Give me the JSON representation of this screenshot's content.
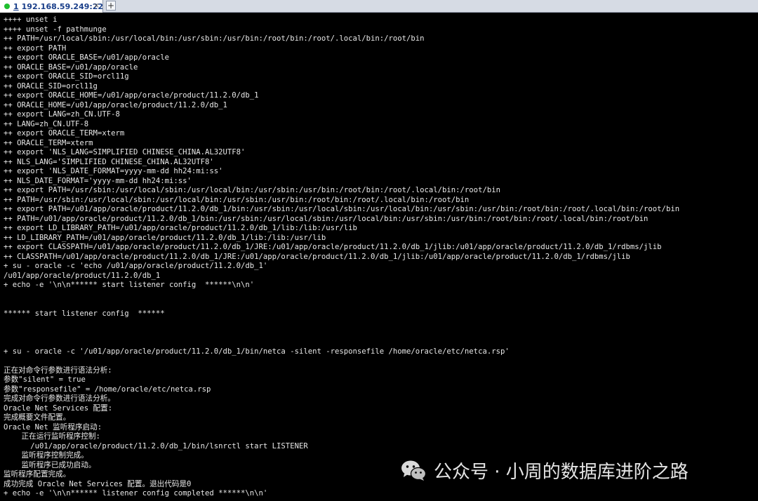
{
  "tab": {
    "number": "1",
    "title": "192.168.59.249:22",
    "close_label": "×",
    "add_label": "+"
  },
  "terminal": {
    "lines": [
      "++++ unset i",
      "++++ unset -f pathmunge",
      "++ PATH=/usr/local/sbin:/usr/local/bin:/usr/sbin:/usr/bin:/root/bin:/root/.local/bin:/root/bin",
      "++ export PATH",
      "++ export ORACLE_BASE=/u01/app/oracle",
      "++ ORACLE_BASE=/u01/app/oracle",
      "++ export ORACLE_SID=orcl11g",
      "++ ORACLE_SID=orcl11g",
      "++ export ORACLE_HOME=/u01/app/oracle/product/11.2.0/db_1",
      "++ ORACLE_HOME=/u01/app/oracle/product/11.2.0/db_1",
      "++ export LANG=zh_CN.UTF-8",
      "++ LANG=zh_CN.UTF-8",
      "++ export ORACLE_TERM=xterm",
      "++ ORACLE_TERM=xterm",
      "++ export 'NLS_LANG=SIMPLIFIED CHINESE_CHINA.AL32UTF8'",
      "++ NLS_LANG='SIMPLIFIED CHINESE_CHINA.AL32UTF8'",
      "++ export 'NLS_DATE_FORMAT=yyyy-mm-dd hh24:mi:ss'",
      "++ NLS_DATE_FORMAT='yyyy-mm-dd hh24:mi:ss'",
      "++ export PATH=/usr/sbin:/usr/local/sbin:/usr/local/bin:/usr/sbin:/usr/bin:/root/bin:/root/.local/bin:/root/bin",
      "++ PATH=/usr/sbin:/usr/local/sbin:/usr/local/bin:/usr/sbin:/usr/bin:/root/bin:/root/.local/bin:/root/bin",
      "++ export PATH=/u01/app/oracle/product/11.2.0/db_1/bin:/usr/sbin:/usr/local/sbin:/usr/local/bin:/usr/sbin:/usr/bin:/root/bin:/root/.local/bin:/root/bin",
      "++ PATH=/u01/app/oracle/product/11.2.0/db_1/bin:/usr/sbin:/usr/local/sbin:/usr/local/bin:/usr/sbin:/usr/bin:/root/bin:/root/.local/bin:/root/bin",
      "++ export LD_LIBRARY_PATH=/u01/app/oracle/product/11.2.0/db_1/lib:/lib:/usr/lib",
      "++ LD_LIBRARY_PATH=/u01/app/oracle/product/11.2.0/db_1/lib:/lib:/usr/lib",
      "++ export CLASSPATH=/u01/app/oracle/product/11.2.0/db_1/JRE:/u01/app/oracle/product/11.2.0/db_1/jlib:/u01/app/oracle/product/11.2.0/db_1/rdbms/jlib",
      "++ CLASSPATH=/u01/app/oracle/product/11.2.0/db_1/JRE:/u01/app/oracle/product/11.2.0/db_1/jlib:/u01/app/oracle/product/11.2.0/db_1/rdbms/jlib",
      "+ su - oracle -c 'echo /u01/app/oracle/product/11.2.0/db_1'",
      "/u01/app/oracle/product/11.2.0/db_1",
      "+ echo -e '\\n\\n****** start listener config  ******\\n\\n'",
      "",
      "",
      "****** start listener config  ******",
      "",
      "",
      "",
      "+ su - oracle -c '/u01/app/oracle/product/11.2.0/db_1/bin/netca -silent -responsefile /home/oracle/etc/netca.rsp'",
      "",
      "正在对命令行参数进行语法分析:",
      "参数\"silent\" = true",
      "参数\"responsefile\" = /home/oracle/etc/netca.rsp",
      "完成对命令行参数进行语法分析。",
      "Oracle Net Services 配置:",
      "完成概要文件配置。",
      "Oracle Net 监听程序启动:",
      "    正在运行监听程序控制:",
      "      /u01/app/oracle/product/11.2.0/db_1/bin/lsnrctl start LISTENER",
      "    监听程序控制完成。",
      "    监听程序已成功启动。",
      "监听程序配置完成。",
      "成功完成 Oracle Net Services 配置。退出代码是0",
      "+ echo -e '\\n\\n****** listener config completed ******\\n\\n'"
    ]
  },
  "watermark": {
    "text": "公众号 · 小周的数据库进阶之路",
    "icon": "wechat-icon"
  }
}
